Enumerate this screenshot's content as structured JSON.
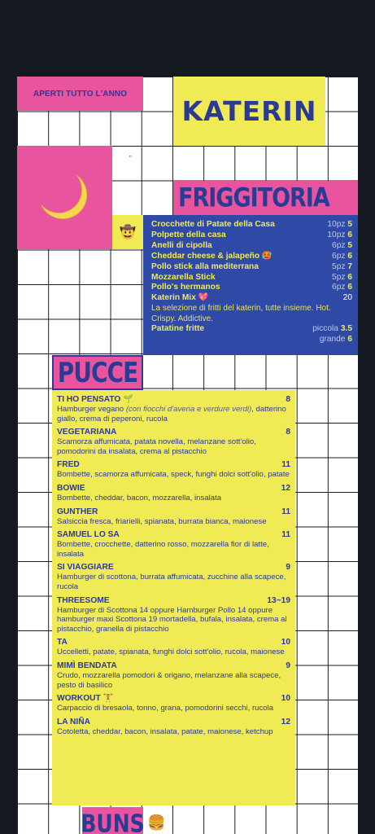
{
  "header": {
    "open_label": "APERTI TUTTO L'ANNO",
    "logo_text": "KATERIN",
    "marker": "\""
  },
  "friggitoria": {
    "title": "FRIGGITORIA",
    "items": [
      {
        "name": "Crocchette di Patate della Casa",
        "qty": "10pz",
        "price": "5"
      },
      {
        "name": "Polpette della casa",
        "qty": "10pz",
        "price": "6"
      },
      {
        "name": "Anelli di cipolla",
        "qty": "6pz",
        "price": "5"
      },
      {
        "name": "Cheddar cheese & jalapeño 🥵",
        "qty": "6pz",
        "price": "6"
      },
      {
        "name": "Pollo stick alla mediterrana",
        "qty": "5pz",
        "price": "7"
      },
      {
        "name": "Mozzarella Stick",
        "qty": "5pz",
        "price": "6"
      },
      {
        "name": "Pollo's hermanos",
        "qty": "6pz",
        "price": "6"
      }
    ],
    "mix": {
      "name": "Katerin Mix 💖",
      "price": "20",
      "desc": "La selezione di fritti del katerin, tutte insieme. Hot. Crispy. Addictive."
    },
    "fries": {
      "name": "Patatine fritte",
      "small_label": "piccola",
      "small_price": "3.5",
      "large_label": "grande",
      "large_price": "6"
    }
  },
  "pucce": {
    "title": "PUCCE",
    "items": [
      {
        "name": "TI HO PENSATO 🌱",
        "price": "8",
        "desc": "Hamburger vegano",
        "desc_it": "(con fiocchi d'avena e verdure verdi)",
        "desc_tail": ", datterino giallo, crema di peperoni, rucola"
      },
      {
        "name": "VEGETARIANA",
        "price": "8",
        "desc": "Scamorza affumicata, patata novella, melanzane sott'olio, pomodorini da insalata, crema al pistacchio"
      },
      {
        "name": "FRED",
        "price": "11",
        "desc": "Bombette, scamorza affumicata, speck, funghi dolci sott'olio, patate"
      },
      {
        "name": "BOWIE",
        "price": "12",
        "desc": "Bombette, cheddar, bacon, mozzarella, insalata"
      },
      {
        "name": "GUNTHER",
        "price": "11",
        "desc": "Salsiccia fresca, friarielli, spianata, burrata bianca, maionese"
      },
      {
        "name": "SAMUEL LO SA",
        "price": "11",
        "desc": "Bombette, crocchette, datterino rosso, mozzarella fior di latte, insalata"
      },
      {
        "name": "SI VIAGGIARE",
        "price": "9",
        "desc": "Hamburger di scottona, burrata affumicata, zucchine alla scapece, rucola"
      },
      {
        "name": "THREESOME",
        "price": "13~19",
        "desc": "Hamburger di Scottona 14 oppure Hamburger Pollo 14 oppure hamburger maxi Scottona 19 mortadella, bufala, insalata, crema al pistacchio, granella di pistacchio"
      },
      {
        "name": "TA",
        "price": "10",
        "desc": "Uccelletti, patate, spianata, funghi dolci sott'olio, rucola, maionese"
      },
      {
        "name": "MIMÌ BENDATA",
        "price": "9",
        "desc": "Crudo, mozzarella pomodori & origano, melanzane alla scapece, pesto di basilico"
      },
      {
        "name": "WORKOUT 🏋",
        "price": "10",
        "desc": "Carpaccio di bresaola, tonno, grana, pomodorini secchi, rucola"
      },
      {
        "name": "LA NIÑA",
        "price": "12",
        "desc": "Cotoletta, cheddar, bacon, insalata, patate, maionese, ketchup"
      }
    ]
  },
  "buns": {
    "title": "BUNS",
    "icon": "🍔"
  },
  "colors": {
    "pink": "#e8559e",
    "yellow": "#f0ea55",
    "blue": "#2f4aa6",
    "ink": "#2b3a92"
  }
}
